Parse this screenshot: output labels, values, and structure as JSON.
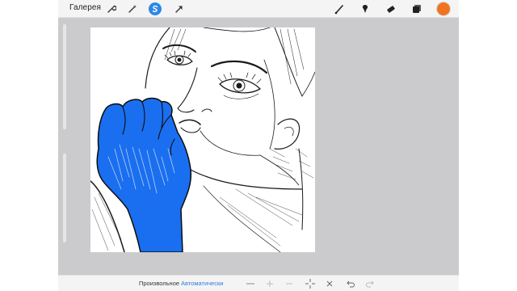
{
  "topbar": {
    "gallery_label": "Галерея",
    "left_icons": [
      "wrench-icon",
      "magic-wand-icon",
      "selection-icon",
      "transform-arrow-icon"
    ],
    "right_icons": [
      "brush-icon",
      "smudge-icon",
      "eraser-icon",
      "layers-icon"
    ],
    "active_color": "#f07420",
    "accent": "#2c87e8"
  },
  "canvas": {
    "fill_color": "#1a6ff0",
    "line_color": "#1b1b1b"
  },
  "bottombar": {
    "freeform_label": "Произвольное",
    "automatic_label": "Автоматически",
    "icons": [
      "minus-icon",
      "plus-icon",
      "minus-icon",
      "crosshair-icon",
      "close-icon",
      "undo-icon",
      "redo-icon"
    ]
  }
}
